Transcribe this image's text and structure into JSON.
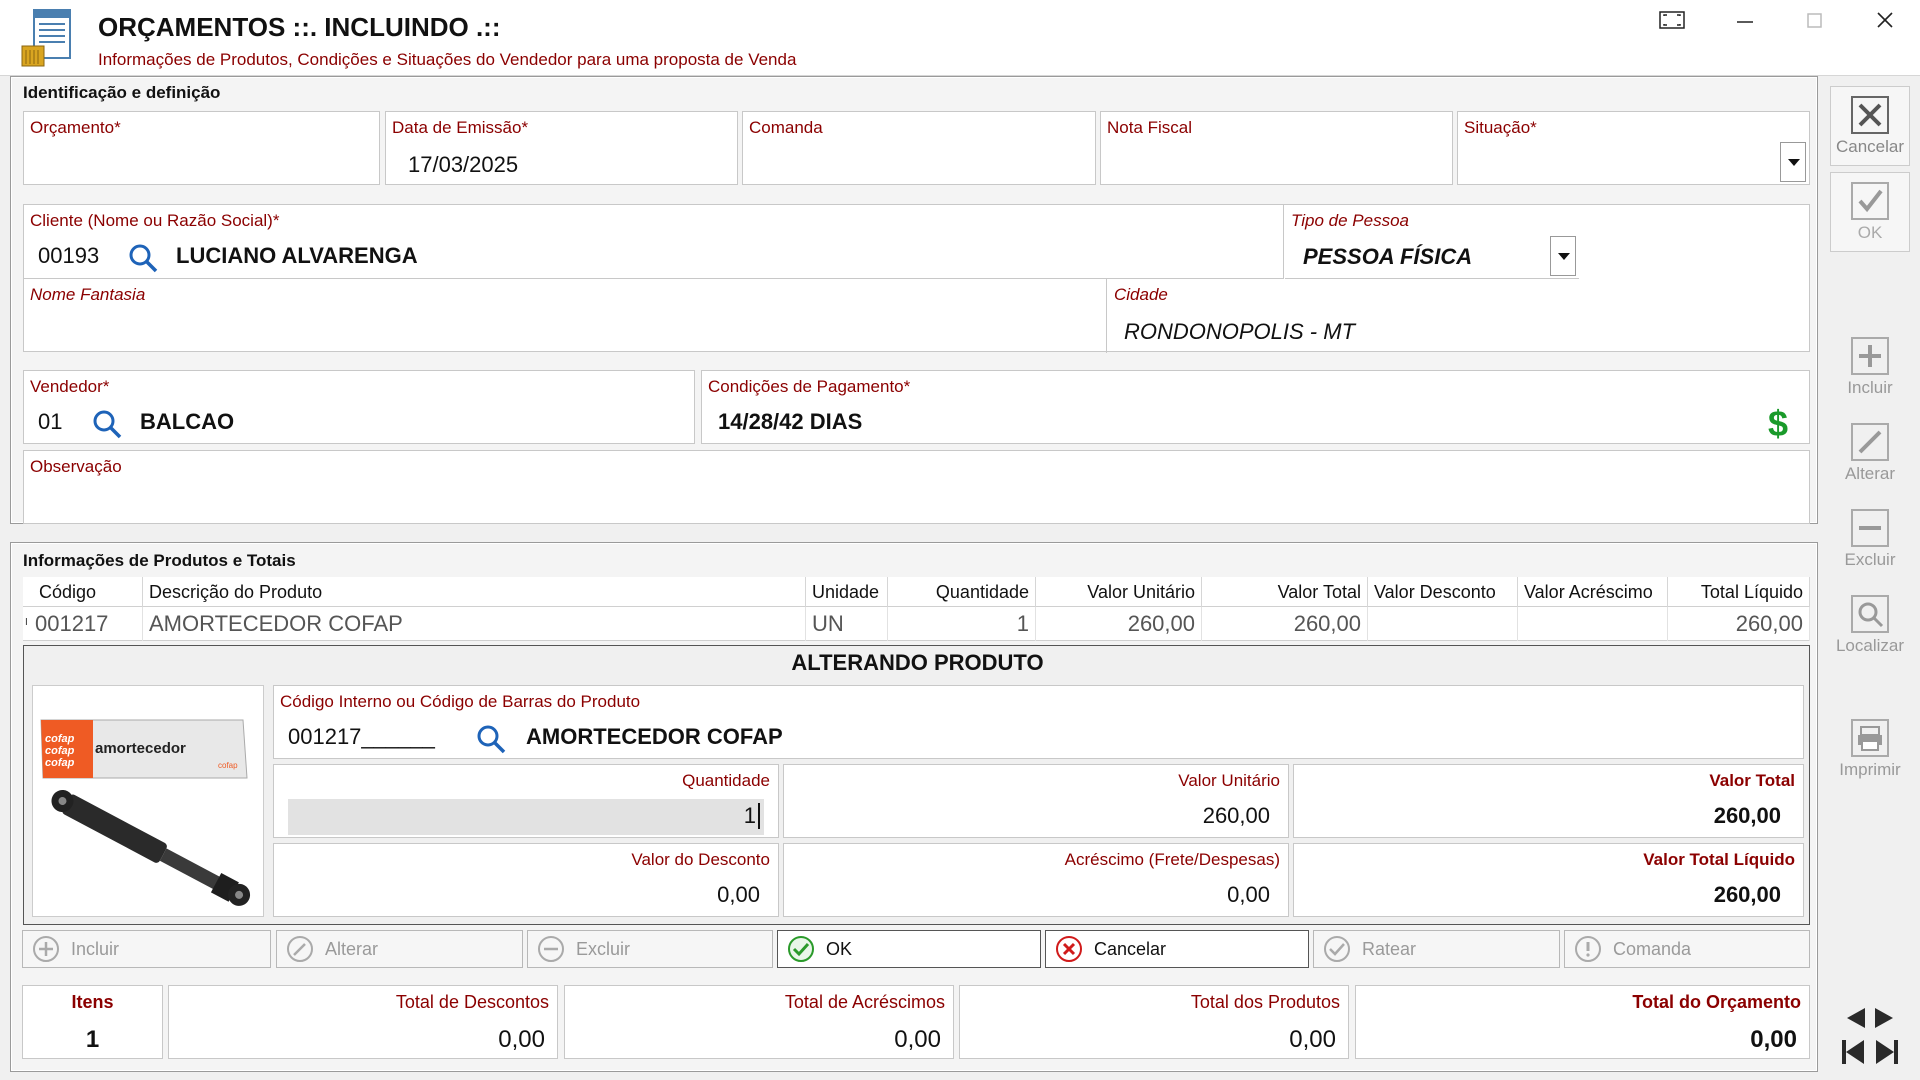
{
  "window": {
    "title": "ORÇAMENTOS ::. INCLUINDO .::",
    "subtitle": "Informações de Produtos, Condições e Situações do Vendedor para uma proposta de Venda"
  },
  "identificacao": {
    "section_title": "Identificação e definição",
    "orcamento_label": "Orçamento*",
    "orcamento_value": "",
    "data_label": "Data de Emissão*",
    "data_value": "17/03/2025",
    "comanda_label": "Comanda",
    "comanda_value": "",
    "nota_label": "Nota Fiscal",
    "nota_value": "",
    "situacao_label": "Situação*",
    "situacao_value": "",
    "cliente_label": "Cliente (Nome ou Razão Social)*",
    "cliente_code": "00193",
    "cliente_name": "LUCIANO ALVARENGA",
    "tipo_label": "Tipo de Pessoa",
    "tipo_value": "PESSOA FÍSICA",
    "fantasia_label": "Nome Fantasia",
    "fantasia_value": "",
    "cidade_label": "Cidade",
    "cidade_value": "RONDONOPOLIS - MT",
    "vendedor_label": "Vendedor*",
    "vendedor_code": "01",
    "vendedor_name": "BALCAO",
    "condicoes_label": "Condições de Pagamento*",
    "condicoes_value": "14/28/42 DIAS",
    "obs_label": "Observação",
    "obs_value": ""
  },
  "produtos": {
    "section_title": "Informações de Produtos e Totais",
    "columns": [
      "Código",
      "Descrição do Produto",
      "Unidade",
      "Quantidade",
      "Valor Unitário",
      "Valor Total",
      "Valor Desconto",
      "Valor Acréscimo",
      "Total Líquido"
    ],
    "rows": [
      {
        "codigo": "001217",
        "descricao": "AMORTECEDOR COFAP",
        "unidade": "UN",
        "quantidade": "1",
        "valor_unitario": "260,00",
        "valor_total": "260,00",
        "valor_desconto": "",
        "valor_acrescimo": "",
        "total_liquido": "260,00"
      }
    ]
  },
  "editor": {
    "title": "ALTERANDO PRODUTO",
    "image_brand": "cofap",
    "image_text": "amortecedor",
    "codigo_label": "Código Interno ou Código de Barras do Produto",
    "codigo_value": "001217______",
    "produto_name": "AMORTECEDOR COFAP",
    "quantidade_label": "Quantidade",
    "quantidade_value": "1",
    "valor_unitario_label": "Valor Unitário",
    "valor_unitario_value": "260,00",
    "valor_total_label": "Valor Total",
    "valor_total_value": "260,00",
    "desconto_label": "Valor do Desconto",
    "desconto_value": "0,00",
    "acrescimo_label": "Acréscimo (Frete/Despesas)",
    "acrescimo_value": "0,00",
    "total_liquido_label": "Valor Total Líquido",
    "total_liquido_value": "260,00"
  },
  "actions": {
    "incluir": "Incluir",
    "alterar": "Alterar",
    "excluir": "Excluir",
    "ok": "OK",
    "cancelar": "Cancelar",
    "ratear": "Ratear",
    "comanda": "Comanda"
  },
  "totais": {
    "itens_label": "Itens",
    "itens_value": "1",
    "descontos_label": "Total de Descontos",
    "descontos_value": "0,00",
    "acrescimos_label": "Total de Acréscimos",
    "acrescimos_value": "0,00",
    "produtos_label": "Total dos Produtos",
    "produtos_value": "0,00",
    "orcamento_label": "Total do Orçamento",
    "orcamento_value": "0,00"
  },
  "sidebar": {
    "cancelar": "Cancelar",
    "ok": "OK",
    "incluir": "Incluir",
    "alterar": "Alterar",
    "excluir": "Excluir",
    "localizar": "Localizar",
    "imprimir": "Imprimir"
  },
  "colors": {
    "label_red": "#8b0000",
    "money_green": "#1a9a2a"
  }
}
